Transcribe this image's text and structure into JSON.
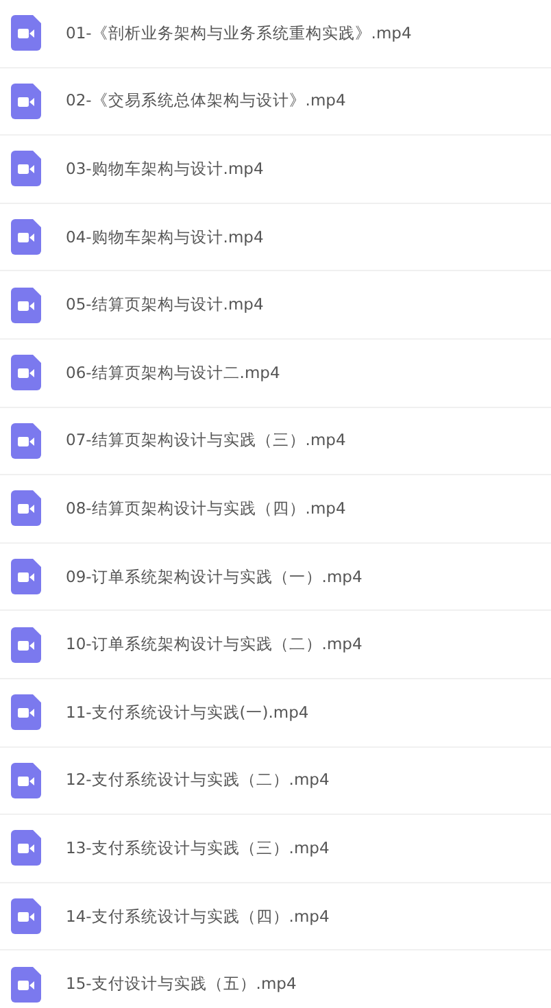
{
  "files": [
    {
      "name": "01-《剖析业务架构与业务系统重构实践》.mp4"
    },
    {
      "name": "02-《交易系统总体架构与设计》.mp4"
    },
    {
      "name": "03-购物车架构与设计.mp4"
    },
    {
      "name": "04-购物车架构与设计.mp4"
    },
    {
      "name": "05-结算页架构与设计.mp4"
    },
    {
      "name": "06-结算页架构与设计二.mp4"
    },
    {
      "name": "07-结算页架构设计与实践（三）.mp4"
    },
    {
      "name": "08-结算页架构设计与实践（四）.mp4"
    },
    {
      "name": "09-订单系统架构设计与实践（一）.mp4"
    },
    {
      "name": "10-订单系统架构设计与实践（二）.mp4"
    },
    {
      "name": "11-支付系统设计与实践(一).mp4"
    },
    {
      "name": "12-支付系统设计与实践（二）.mp4"
    },
    {
      "name": "13-支付系统设计与实践（三）.mp4"
    },
    {
      "name": "14-支付系统设计与实践（四）.mp4"
    },
    {
      "name": "15-支付设计与实践（五）.mp4"
    }
  ]
}
